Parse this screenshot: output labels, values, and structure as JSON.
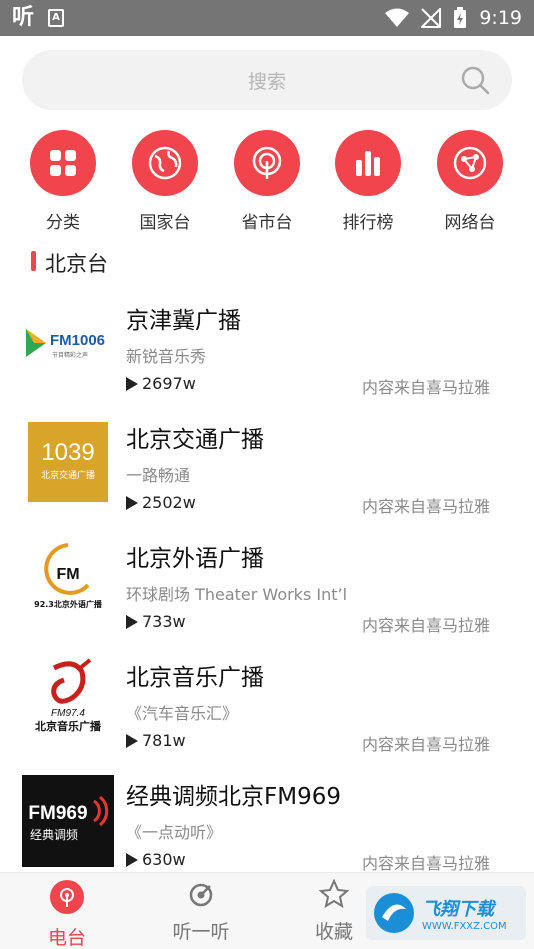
{
  "status_bar": {
    "app_glyph": "听",
    "badge": "A",
    "time": "9:19"
  },
  "search": {
    "placeholder": "搜索"
  },
  "categories": [
    {
      "label": "分类",
      "icon": "grid-icon"
    },
    {
      "label": "国家台",
      "icon": "globe-icon"
    },
    {
      "label": "省市台",
      "icon": "location-pin-icon"
    },
    {
      "label": "排行榜",
      "icon": "bar-chart-icon"
    },
    {
      "label": "网络台",
      "icon": "network-globe-icon"
    }
  ],
  "section": {
    "title": "北京台"
  },
  "stations": [
    {
      "name": "京津冀广播",
      "subtitle": "新锐音乐秀",
      "plays": "2697w",
      "source": "内容来自喜马拉雅",
      "logo": {
        "line1": "FM1006",
        "line2": "节目精彩之声",
        "bg": "#ffffff",
        "color": "#1e5aa8"
      }
    },
    {
      "name": "北京交通广播",
      "subtitle": "一路畅通",
      "plays": "2502w",
      "source": "内容来自喜马拉雅",
      "logo": {
        "line1": "1039",
        "line2": "北京交通广播",
        "bg": "#d9a42a",
        "color": "#ffffff"
      }
    },
    {
      "name": "北京外语广播",
      "subtitle": "环球剧场 Theater Works Int’l",
      "plays": "733w",
      "source": "内容来自喜马拉雅",
      "logo": {
        "line1": "FM",
        "line2": "92.3北京外语广播",
        "bg": "#ffffff",
        "color": "#111111"
      }
    },
    {
      "name": "北京音乐广播",
      "subtitle": "《汽车音乐汇》",
      "plays": "781w",
      "source": "内容来自喜马拉雅",
      "logo": {
        "line1": "FM97.4",
        "line2": "北京音乐广播",
        "bg": "#ffffff",
        "color": "#111111"
      }
    },
    {
      "name": "经典调频北京FM969",
      "subtitle": "《一点动听》",
      "plays": "630w",
      "source": "内容来自喜马拉雅",
      "logo": {
        "line1": "FM969",
        "line2": "经典调频",
        "bg": "#111111",
        "color": "#ffffff"
      }
    }
  ],
  "bottom_nav": [
    {
      "label": "电台",
      "icon": "radio-icon",
      "active": true
    },
    {
      "label": "听一听",
      "icon": "listen-icon",
      "active": false
    },
    {
      "label": "收藏",
      "icon": "star-icon",
      "active": false
    }
  ],
  "watermark": {
    "main": "飞翔下载",
    "sub": "WWW.FXXZ.COM"
  },
  "colors": {
    "accent": "#f0454d",
    "status_bar": "#757575"
  }
}
